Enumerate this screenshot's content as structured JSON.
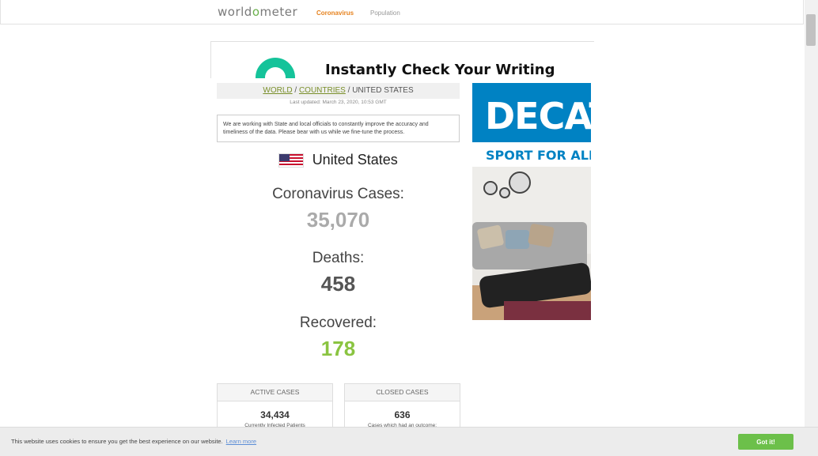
{
  "header": {
    "logo_prefix": "world",
    "logo_o": "o",
    "logo_suffix": "meter",
    "nav": [
      "Coronavirus",
      "Population"
    ]
  },
  "top_ad": {
    "headline": "Instantly Check Your Writing"
  },
  "breadcrumb": {
    "world": "WORLD",
    "sep1": " / ",
    "countries": "COUNTRIES",
    "sep2": " / ",
    "current": "UNITED STATES"
  },
  "last_updated": "Last updated: March 23, 2020, 10:53 GMT",
  "notice": "We are working with State and local officials to constantly improve the accuracy and timeliness of the data. Please bear with us while we fine-tune the process.",
  "country": "United States",
  "stats": {
    "cases_label": "Coronavirus Cases:",
    "cases_value": "35,070",
    "deaths_label": "Deaths:",
    "deaths_value": "458",
    "recovered_label": "Recovered:",
    "recovered_value": "178"
  },
  "active": {
    "header": "ACTIVE CASES",
    "value": "34,434",
    "sub": "Currently Infected Patients"
  },
  "closed": {
    "header": "CLOSED CASES",
    "value": "636",
    "sub": "Cases which had an outcome:"
  },
  "side_ad": {
    "brand": "DECAT",
    "tagline": "SPORT FOR ALL -"
  },
  "cookie": {
    "message": "This website uses cookies to ensure you get the best experience on our website.",
    "learn_more": "Learn more",
    "button": "Got it!"
  },
  "colors": {
    "accent": "#e6821e",
    "recovered": "#8ac441",
    "cases": "#aaaaaa",
    "ad_blue": "#0082c3",
    "button_green": "#6cc04a"
  }
}
